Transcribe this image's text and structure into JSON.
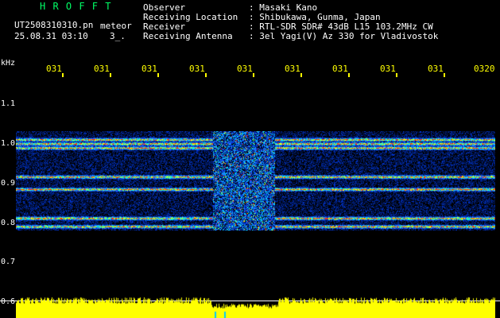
{
  "brand": "H R O F F T",
  "file": {
    "name": "UT2508310310.pn",
    "kind": "meteor"
  },
  "timestamp": {
    "datetime": "25.08.31 03:10",
    "count": "3_."
  },
  "header": {
    "labels": [
      "Observer",
      "Receiving Location",
      "Receiver",
      "Receiving Antenna"
    ],
    "values": [
      ": Masaki Kano",
      ": Shibukawa, Gunma, Japan",
      ": RTL-SDR SDR# 43dB L15 103.2MHz CW",
      ": 3el Yagi(V) Az 330 for Vladivostok"
    ]
  },
  "axis": {
    "unit": "kHz",
    "x_ticks": [
      "031",
      "031",
      "031",
      "031",
      "031",
      "031",
      "031",
      "031",
      "031",
      "0320"
    ],
    "y_ticks": [
      "1.1",
      "1.0",
      "0.9",
      "0.8",
      "0.7",
      "0.6"
    ]
  },
  "colors": {
    "brand": "#00ff66",
    "axis_x": "#ffff00",
    "peaks": "#ffff00",
    "background": "#000000"
  },
  "spectrogram": {
    "freq_range_khz": [
      0.78,
      1.02
    ],
    "bands_khz": [
      1.0,
      0.99,
      0.98,
      0.91,
      0.88,
      0.81,
      0.79
    ],
    "burst_time_fraction": [
      0.41,
      0.54
    ]
  }
}
